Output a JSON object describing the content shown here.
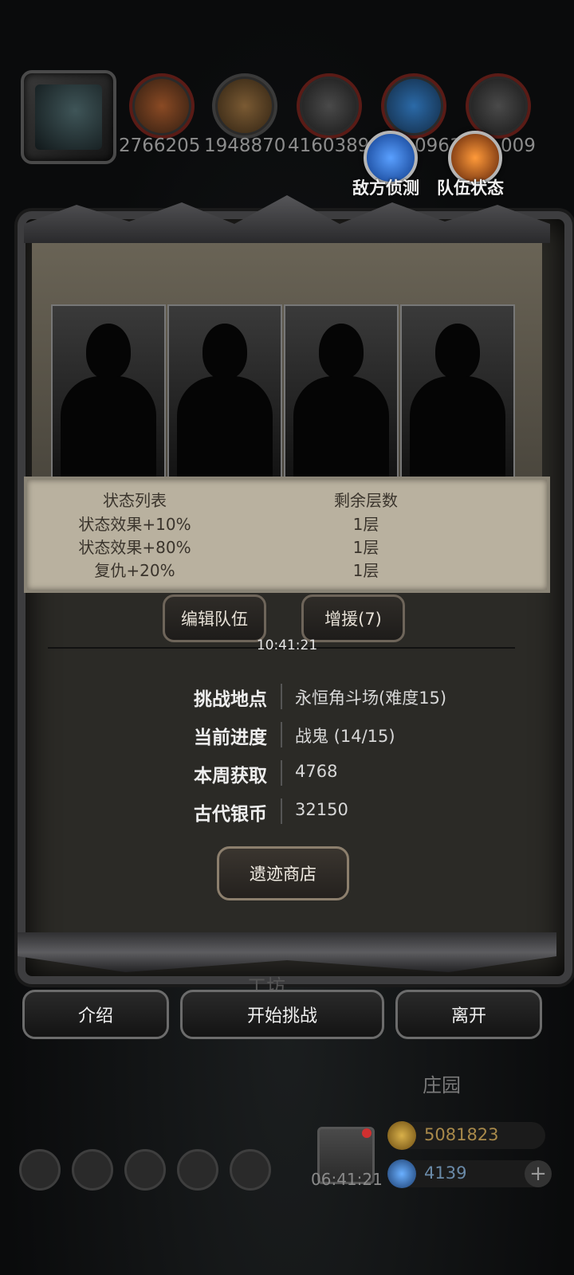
{
  "resources": [
    {
      "name": "food",
      "value": "2766205",
      "color": "#8a4a24"
    },
    {
      "name": "wood",
      "value": "1948870",
      "color": "#7a5a33"
    },
    {
      "name": "stone",
      "value": "4160389",
      "color": "#3c3c3c"
    },
    {
      "name": "crystal",
      "value": "0961",
      "color": "#2b6aa8"
    },
    {
      "name": "iron",
      "value": "009",
      "color": "#3a3a3a"
    }
  ],
  "header_buttons": {
    "enemy_scout": "敌方侦测",
    "team_status": "队伍状态"
  },
  "status_table": {
    "headers": [
      "状态列表",
      "剩余层数"
    ],
    "rows": [
      {
        "effect": "状态效果+10%",
        "layers": "1层"
      },
      {
        "effect": "状态效果+80%",
        "layers": "1层"
      },
      {
        "effect": "复仇+20%",
        "layers": "1层"
      }
    ]
  },
  "actions": {
    "edit_team": "编辑队伍",
    "reinforce": "增援(7)",
    "timer": "10:41:21"
  },
  "info": [
    {
      "label": "挑战地点",
      "value": "永恒角斗场(难度15)"
    },
    {
      "label": "当前进度",
      "value": "战鬼 (14/15)"
    },
    {
      "label": "本周获取",
      "value": "4768"
    },
    {
      "label": "古代银币",
      "value": "32150"
    }
  ],
  "shop_button": "遗迹商店",
  "bottom_buttons": {
    "intro": "介绍",
    "start": "开始挑战",
    "leave": "离开"
  },
  "background": {
    "workshop": "工坊",
    "manor": "庄园",
    "gift_timer": "06:41:21",
    "gold": "5081823",
    "gems": "4139"
  }
}
